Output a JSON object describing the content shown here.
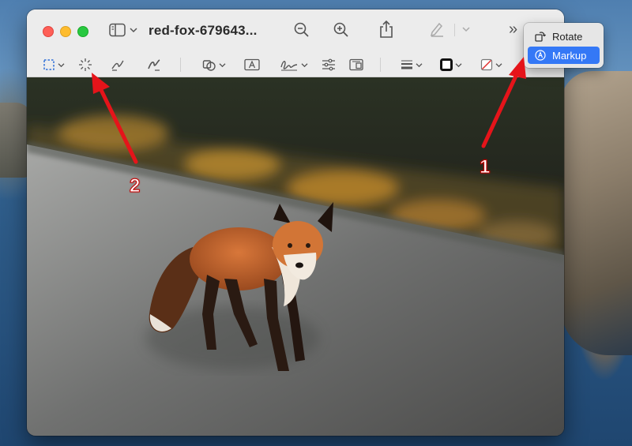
{
  "window": {
    "title": "red-fox-679643...",
    "more_glyph": "»"
  },
  "menu": {
    "items": [
      {
        "label": "Rotate",
        "icon": "rotate-icon",
        "selected": false
      },
      {
        "label": "Markup",
        "icon": "markup-icon",
        "selected": true
      }
    ]
  },
  "annotations": {
    "label_1": "1",
    "label_2": "2"
  },
  "colors": {
    "accent": "#3478f6",
    "arrow": "#e5141a"
  },
  "toolbar_icons": [
    "rectangular-selection-icon",
    "instant-alpha-icon",
    "sketch-icon",
    "draw-icon",
    "shapes-icon",
    "text-icon",
    "sign-icon",
    "adjust-color-icon",
    "adjust-size-icon",
    "shape-style-icon",
    "border-color-icon",
    "fill-color-icon"
  ]
}
